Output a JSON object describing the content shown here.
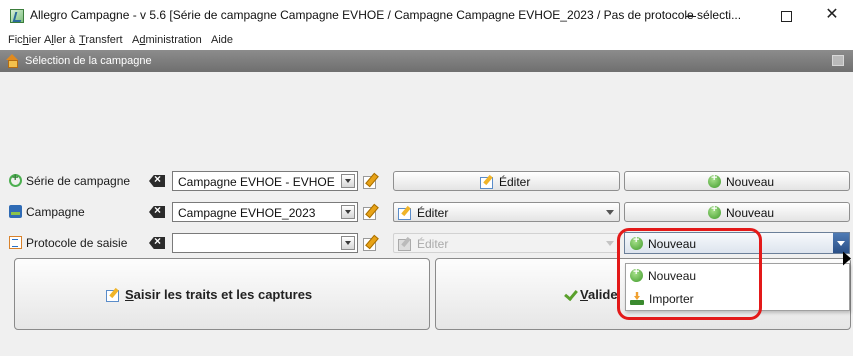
{
  "window": {
    "title": "Allegro Campagne - v 5.6 [Série de campagne Campagne EVHOE / Campagne Campagne EVHOE_2023 / Pas de protocole sélecti...",
    "minimize": "—",
    "maximize": "☐",
    "close": "✕"
  },
  "menubar": {
    "items": [
      {
        "pre": "Fic",
        "acc": "h",
        "post": "ier"
      },
      {
        "pre": "A",
        "acc": "l",
        "post": "ler à"
      },
      {
        "pre": "",
        "acc": "T",
        "post": "ransfert"
      },
      {
        "pre": "A",
        "acc": "d",
        "post": "ministration"
      },
      {
        "pre": "Aide",
        "acc": "",
        "post": ""
      }
    ]
  },
  "panel": {
    "title": "Sélection de la campagne"
  },
  "rows": {
    "serie": {
      "label": "Série de campagne",
      "value": "Campagne EVHOE - EVHOE",
      "edit_label": "Éditer",
      "new_label": "Nouveau"
    },
    "campagne": {
      "label": "Campagne",
      "value": "Campagne EVHOE_2023",
      "edit_label": "Éditer",
      "new_label": "Nouveau"
    },
    "protocole": {
      "label": "Protocole de saisie",
      "value": "",
      "edit_label": "Éditer",
      "new_label": "Nouveau"
    }
  },
  "dropdown": {
    "options": [
      "Nouveau",
      "Importer"
    ]
  },
  "actions": {
    "saisir": {
      "acc": "S",
      "rest": "aisir les traits et les captures"
    },
    "valider": {
      "acc": "V",
      "rest": "alide"
    }
  },
  "colors": {
    "highlight": "#e31919",
    "header_bg": "#7f7f7f",
    "active_select": "#2a4f86"
  }
}
